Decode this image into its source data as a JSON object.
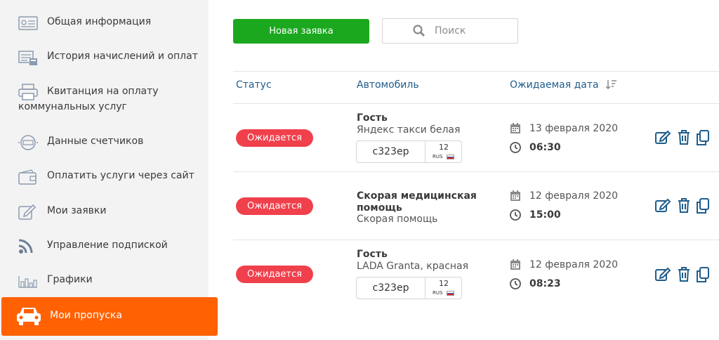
{
  "sidebar": {
    "items": [
      {
        "label": "Общая информация",
        "icon": "id-card-icon"
      },
      {
        "label": "История начислений и оплат",
        "icon": "calculator-icon"
      },
      {
        "label": "Квитанция на оплату",
        "label2": "коммунальных услуг",
        "icon": "printer-icon"
      },
      {
        "label": "Данные счетчиков",
        "icon": "meter-icon"
      },
      {
        "label": "Оплатить услуги через сайт",
        "icon": "wallet-icon"
      },
      {
        "label": "Мои заявки",
        "icon": "edit-icon"
      },
      {
        "label": "Управление подпиской",
        "icon": "rss-icon"
      },
      {
        "label": "Графики",
        "icon": "bar-chart-icon"
      }
    ],
    "active": {
      "label": "Мои пропуска",
      "icon": "car-icon"
    }
  },
  "toolbar": {
    "new_label": "Новая заявка",
    "search_placeholder": "Поиск"
  },
  "table": {
    "headers": {
      "status": "Статус",
      "car": "Автомобиль",
      "date": "Ожидаемая дата"
    },
    "rows": [
      {
        "status": "Ожидается",
        "title": "Гость",
        "subtitle": "Яндекс такси белая",
        "plate": {
          "number": "с323ер",
          "region": "12",
          "country": "RUS"
        },
        "date": "13 февраля 2020",
        "time": "06:30"
      },
      {
        "status": "Ожидается",
        "title": "Скорая медицинская помощь",
        "subtitle": "Скорая помощь",
        "date": "12 февраля 2020",
        "time": "15:00"
      },
      {
        "status": "Ожидается",
        "title": "Гость",
        "subtitle": "LADA Granta, красная",
        "plate": {
          "number": "с323ер",
          "region": "12",
          "country": "RUS"
        },
        "date": "12 февраля 2020",
        "time": "08:23"
      }
    ]
  },
  "colors": {
    "accent": "#ff6103",
    "primary": "#1ba81f",
    "status": "#f0404c",
    "link": "#1f5c8b"
  }
}
